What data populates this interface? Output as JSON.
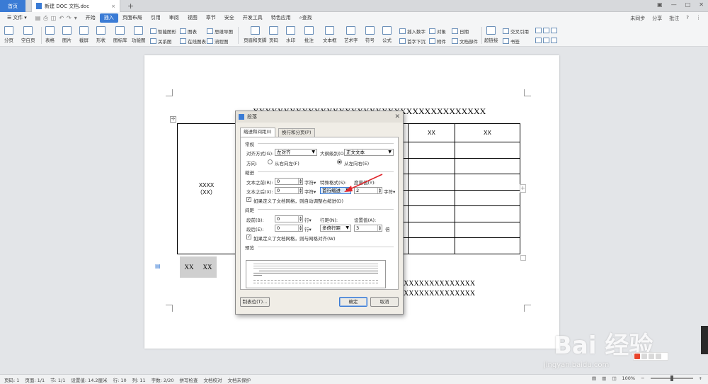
{
  "titlebar": {
    "home_tab": "首页",
    "doc_tab": "新建 DOC 文档.doc",
    "add_tab": "+"
  },
  "menubar": {
    "file": "文件",
    "items": [
      "开始",
      "插入",
      "页面布局",
      "引用",
      "审阅",
      "视图",
      "章节",
      "安全",
      "开发工具",
      "特色应用"
    ],
    "active_item": "插入",
    "search": "查找",
    "right": [
      "未同步",
      "分享",
      "批注"
    ]
  },
  "ribbon": {
    "large": [
      "分页",
      "空白页",
      "表格",
      "图片",
      "截屏",
      "形状",
      "图标库",
      "功能图",
      "页眉和页脚",
      "页码",
      "水印",
      "批注",
      "文本框",
      "艺术字",
      "符号",
      "公式",
      "超链接",
      "书签"
    ],
    "small": [
      "智能图形",
      "图表",
      "思维导图",
      "关系图",
      "在线图表",
      "流程图",
      "插入数字",
      "对象",
      "日期",
      "首字下沉",
      "附件",
      "文档部件",
      "交叉引用"
    ]
  },
  "document": {
    "heading": "XXXXXXXXXXXXXXXXXXXXXXXXXXXXXXXXXXXXXX",
    "table": {
      "merged_cell_line1": "XXXX",
      "merged_cell_line2": "（XX）",
      "header_cells": [
        "XX",
        "XX"
      ]
    },
    "selected_block": [
      "XX",
      "XX"
    ],
    "body_line1": "XXXXXXXXXXXXXX",
    "body_line2": "XXXXXXXXXXXXXX"
  },
  "dialog": {
    "title": "段落",
    "tabs": [
      "缩进和间距(I)",
      "换行和分页(P)"
    ],
    "general": {
      "section": "常规",
      "alignment_label": "对齐方式(G):",
      "alignment_value": "左对齐",
      "outline_label": "大纲级别(O):",
      "outline_value": "正文文本",
      "direction_label": "方向:",
      "rtl_label": "从右向左(F)",
      "ltr_label": "从左向右(E)"
    },
    "indent": {
      "section": "缩进",
      "before_label": "文本之前(R):",
      "before_value": "0",
      "after_label": "文本之后(X):",
      "after_value": "0",
      "unit": "字符▾",
      "special_label": "特殊格式(S):",
      "special_value": "首行缩进",
      "measure_label": "度量值(Y):",
      "measure_value": "2",
      "auto_adjust": "如果定义了文档网格，则自动调整右缩进(D)"
    },
    "spacing": {
      "section": "间距",
      "before_label": "段前(B):",
      "before_value": "0",
      "after_label": "段后(E):",
      "after_value": "0",
      "unit": "行▾",
      "line_label": "行距(N):",
      "line_value": "多倍行距",
      "set_label": "设置值(A):",
      "set_value": "3",
      "set_unit": "倍",
      "snap_grid": "如果定义了文档网格，则与网格对齐(W)"
    },
    "preview": {
      "section": "预览"
    },
    "buttons": {
      "tabs": "制表位(T)...",
      "ok": "确定",
      "cancel": "取消"
    }
  },
  "statusbar": {
    "items": [
      "页码: 1",
      "页面: 1/1",
      "节: 1/1",
      "设置值: 14.2厘米",
      "行: 10",
      "列: 11",
      "字数: 2/20",
      "拼写检查",
      "文档校对",
      "文档未保护"
    ],
    "zoom": "100%"
  },
  "watermark": {
    "text": "Bai 经验",
    "url": "jingyan.baidu.com"
  },
  "colors": {
    "accent": "#3a7bd5",
    "arrow": "#e0242a"
  }
}
